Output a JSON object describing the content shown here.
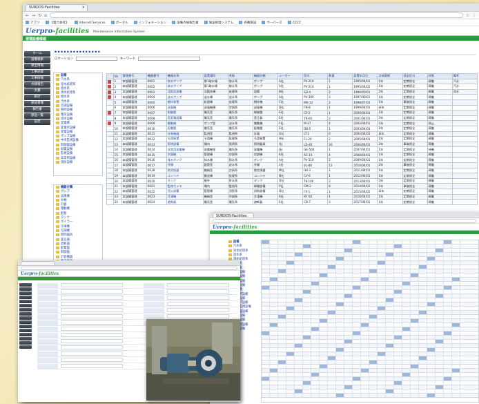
{
  "browser": {
    "tab_title": "SURDOS-Facilities",
    "tab_close": "×",
    "url_text": "",
    "bookmarks": [
      "アプリ",
      "【電力会社】",
      "Internet Services",
      "ポータル",
      "インフォメーション",
      "設備点検報告書",
      "施設管理システム",
      "各種施設",
      "サーバーズ",
      "ZZZZ"
    ]
  },
  "app": {
    "logo_main": "Uerpro",
    "logo_sub": "-facilities",
    "subtitle": "Maintenance Information System",
    "section_title": "現場設備情報",
    "sidebar": [
      "ホーム",
      "設備検索",
      "保全情報",
      "工事記録",
      "工事情報",
      "点検報告",
      "文書",
      "統計",
      "部品管理",
      "報告書",
      "部品一覧",
      "設定"
    ],
    "filter_label": "ロケーション",
    "keyword_label": "キーワード"
  },
  "tree_top": {
    "root": "設備",
    "items": [
      "汽水系",
      "泥水処理系",
      "放水系",
      "清水処理系",
      "給水系",
      "汚水系",
      "空調設備",
      "照明設備",
      "電気設備",
      "排水設備",
      "発電機",
      "変電所設備",
      "受電設備",
      "ポンプ設備",
      "中央監視設備",
      "制御盤設備",
      "弱電設備",
      "監視設備",
      "非常用設備",
      "消防設備"
    ]
  },
  "tree_bottom": {
    "root": "機器分類",
    "items": [
      "ポンプ",
      "送風機",
      "弁類",
      "計器",
      "電動機",
      "配管",
      "タンク",
      "ボイラー",
      "冷凍機",
      "空調機",
      "照明器具",
      "変圧器",
      "遮断器",
      "配電盤",
      "制御盤",
      "計装機器",
      "熱交換器",
      "ろ過装置",
      "攪拌機",
      "コンベヤ"
    ]
  },
  "grid": {
    "headers": [
      "",
      "No",
      "管理番号",
      "機器番号",
      "機器名称",
      "設置場所",
      "系統",
      "機器分類",
      "メーカー",
      "型式",
      "数量",
      "設置年月日",
      "点検周期",
      "保全区分",
      "状態",
      "備考"
    ],
    "rows": [
      [
        "1",
        "本設備管理",
        "0001",
        "取水ポンプ",
        "第1取水棟",
        "取水系",
        "ポンプ",
        "A社",
        "PV-210",
        "1",
        "1995/04/01",
        "1年",
        "定期保全",
        "稼働",
        "汽水"
      ],
      [
        "2",
        "本設備管理",
        "0002",
        "取水ポンプ",
        "第1取水棟",
        "取水系",
        "ポンプ",
        "A社",
        "PV-210",
        "1",
        "1995/04/01",
        "1年",
        "定期保全",
        "稼働",
        "汽水"
      ],
      [
        "3",
        "本設備管理",
        "0003",
        "沈殿池設備",
        "沈殿池棟",
        "処理系",
        "設備",
        "B社",
        "SD-4",
        "2",
        "1996/05/01",
        "2年",
        "定期保全",
        "稼働",
        "泥水"
      ],
      [
        "4",
        "本設備管理",
        "0004",
        "送水ポンプ",
        "送水棟",
        "送水系",
        "ポンプ",
        "A社",
        "PV-300",
        "3",
        "1997/06/01",
        "1年",
        "定期保全",
        "稼働",
        ""
      ],
      [
        "5",
        "本設備管理",
        "0005",
        "攪拌装置",
        "処理棟",
        "処理系",
        "攪拌機",
        "C社",
        "MX-12",
        "2",
        "1998/07/01",
        "1年",
        "事後保全",
        "稼働",
        ""
      ],
      [
        "6",
        "本設備管理",
        "0006",
        "送風機",
        "送風機棟",
        "空調系",
        "送風機",
        "D社",
        "FN-8",
        "1",
        "1999/04/01",
        "半年",
        "定期保全",
        "稼働",
        ""
      ],
      [
        "7",
        "本設備管理",
        "0007",
        "制御盤",
        "電気室",
        "電気系",
        "制御盤",
        "E社",
        "CP-2",
        "1",
        "2000/04/01",
        "1年",
        "定期保全",
        "稼働",
        ""
      ],
      [
        "8",
        "本設備管理",
        "0008",
        "受変電設備",
        "電気室",
        "電気系",
        "変圧器",
        "E社",
        "TR-60",
        "2",
        "2001/04/01",
        "3年",
        "定期保全",
        "稼働",
        ""
      ],
      [
        "9",
        "本設備管理",
        "0009",
        "電動機",
        "ポンプ室",
        "送水系",
        "電動機",
        "F社",
        "M-37",
        "4",
        "2002/04/01",
        "1年",
        "定期保全",
        "停止",
        ""
      ],
      [
        "10",
        "本設備管理",
        "0010",
        "配電盤",
        "電気室",
        "電気系",
        "配電盤",
        "E社",
        "DB-5",
        "1",
        "2003/04/01",
        "1年",
        "定期保全",
        "稼働",
        ""
      ],
      [
        "11",
        "本設備管理",
        "0011",
        "計装機器",
        "監視室",
        "監視系",
        "計器",
        "G社",
        "LT-1",
        "6",
        "2004/04/01",
        "半年",
        "定期保全",
        "稼働",
        ""
      ],
      [
        "12",
        "本設備管理",
        "0012",
        "ろ過装置",
        "ろ過棟",
        "処理系",
        "ろ過装置",
        "H社",
        "FL-20",
        "2",
        "2005/04/01",
        "1年",
        "定期保全",
        "稼働",
        ""
      ],
      [
        "13",
        "本設備管理",
        "0013",
        "照明設備",
        "場内",
        "照明系",
        "照明器具",
        "I社",
        "LD-40",
        "30",
        "2006/04/01",
        "2年",
        "事後保全",
        "稼働",
        ""
      ],
      [
        "14",
        "本設備管理",
        "0014",
        "非常用発電機",
        "発電機室",
        "電気系",
        "発電機",
        "J社",
        "GE-500",
        "1",
        "2007/04/01",
        "1年",
        "定期保全",
        "待機",
        ""
      ],
      [
        "15",
        "本設備管理",
        "0015",
        "空調機",
        "管理棟",
        "空調系",
        "空調機",
        "K社",
        "AC-15",
        "4",
        "2008/04/01",
        "1年",
        "定期保全",
        "稼働",
        ""
      ],
      [
        "16",
        "本設備管理",
        "0016",
        "排水ポンプ",
        "排水棟",
        "排水系",
        "ポンプ",
        "A社",
        "PV-110",
        "2",
        "2009/04/01",
        "1年",
        "定期保全",
        "稼働",
        ""
      ],
      [
        "17",
        "本設備管理",
        "0017",
        "弁類",
        "配管室",
        "送水系",
        "弁類",
        "L社",
        "VL-80",
        "12",
        "2010/04/01",
        "2年",
        "事後保全",
        "稼働",
        ""
      ],
      [
        "18",
        "本設備管理",
        "0018",
        "熱交換器",
        "機械室",
        "空調系",
        "熱交換器",
        "M社",
        "HX-3",
        "1",
        "2011/04/01",
        "1年",
        "定期保全",
        "稼働",
        ""
      ],
      [
        "19",
        "本設備管理",
        "0019",
        "コンベヤ",
        "搬送棟",
        "処理系",
        "コンベヤ",
        "N社",
        "CV-6",
        "1",
        "2012/04/01",
        "1年",
        "定期保全",
        "稼働",
        ""
      ],
      [
        "20",
        "本設備管理",
        "0020",
        "タンク",
        "屋外",
        "貯水系",
        "タンク",
        "O社",
        "TK-100",
        "2",
        "2013/04/01",
        "3年",
        "定期保全",
        "稼働",
        ""
      ],
      [
        "21",
        "本設備管理",
        "0021",
        "監視カメラ",
        "場内",
        "監視系",
        "弱電設備",
        "P社",
        "CM-2",
        "8",
        "2014/04/01",
        "1年",
        "事後保全",
        "稼働",
        ""
      ],
      [
        "22",
        "本設備管理",
        "0022",
        "消火設備",
        "管理棟",
        "消防系",
        "消防設備",
        "Q社",
        "FX-1",
        "1",
        "2015/04/01",
        "半年",
        "定期保全",
        "稼働",
        ""
      ],
      [
        "23",
        "本設備管理",
        "0023",
        "冷凍機",
        "機械室",
        "空調系",
        "冷凍機",
        "R社",
        "RF-50",
        "1",
        "2016/04/01",
        "1年",
        "定期保全",
        "稼働",
        ""
      ],
      [
        "24",
        "本設備管理",
        "0024",
        "遮断器",
        "電気室",
        "電気系",
        "遮断器",
        "E社",
        "CB-7",
        "3",
        "2017/04/01",
        "1年",
        "定期保全",
        "稼働",
        ""
      ]
    ]
  },
  "colors": {
    "green": "#2f9a3a",
    "link": "#2148a8",
    "header": "#dfe8f3"
  },
  "photo": {
    "caption": ""
  }
}
